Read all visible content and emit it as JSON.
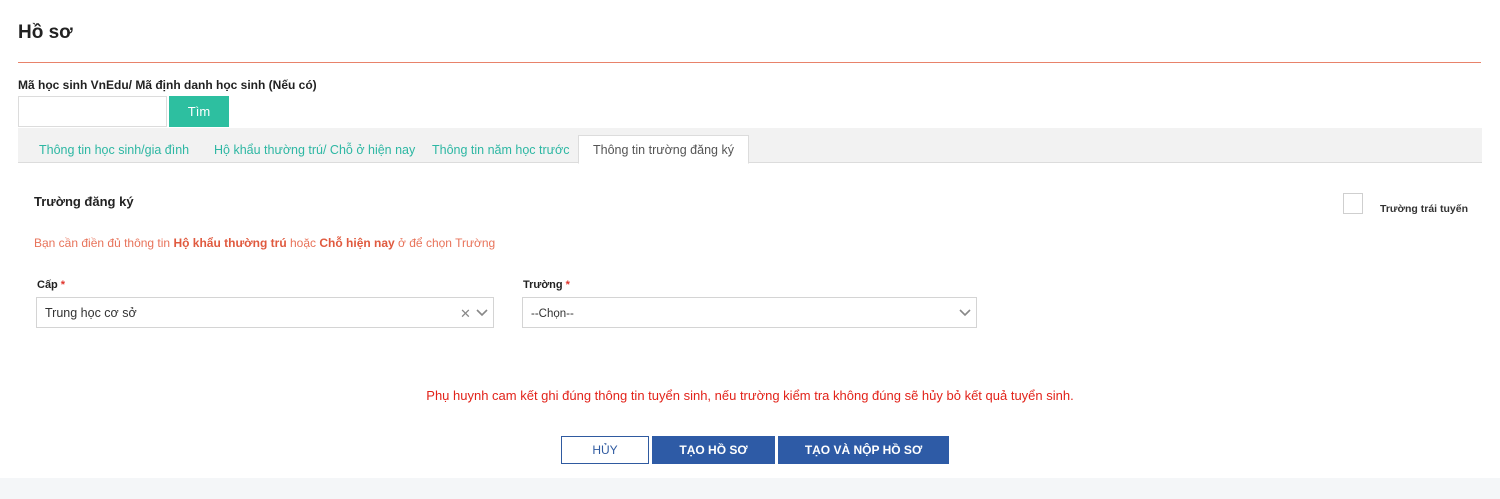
{
  "page": {
    "title": "Hồ sơ"
  },
  "lookup": {
    "label": "Mã học sinh VnEdu/ Mã định danh học sinh (Nếu có)",
    "input_value": "",
    "button_label": "Tìm"
  },
  "tabs": [
    {
      "label": "Thông tin học sinh/gia đình",
      "active": false
    },
    {
      "label": "Hộ khẩu thường trú/ Chỗ ở hiện nay",
      "active": false
    },
    {
      "label": "Thông tin năm học trước",
      "active": false
    },
    {
      "label": "Thông tin trường đăng ký",
      "active": true
    }
  ],
  "section": {
    "title": "Trường đăng ký",
    "overflow_checkbox_label": "Trường trái tuyến",
    "overflow_checked": false
  },
  "notice": {
    "prefix": "Bạn cần điền đủ thông tin ",
    "bold1": "Hộ khẩu thường trú",
    "middle": " hoặc ",
    "bold2": "Chỗ hiện nay",
    "suffix": " ở để chọn Trường"
  },
  "fields": {
    "level": {
      "label": "Cấp",
      "required_mark": "*",
      "value": "Trung học cơ sở"
    },
    "school": {
      "label": "Trường",
      "required_mark": "*",
      "value": "--Chọn--"
    }
  },
  "commitment": "Phụ huynh cam kết ghi đúng thông tin tuyển sinh, nếu trường kiểm tra không đúng sẽ hủy bỏ kết quả tuyển sinh.",
  "actions": {
    "cancel": "HỦY",
    "create": "TẠO HỒ SƠ",
    "create_submit": "TẠO VÀ NỘP HỒ SƠ"
  },
  "icons": {
    "clear": "clear-icon",
    "chevron": "chevron-down-icon"
  },
  "colors": {
    "accent_teal": "#2dbfa0",
    "primary_blue": "#2e5ba6",
    "warning_orange": "#e8735a",
    "alert_red": "#e2231a"
  }
}
